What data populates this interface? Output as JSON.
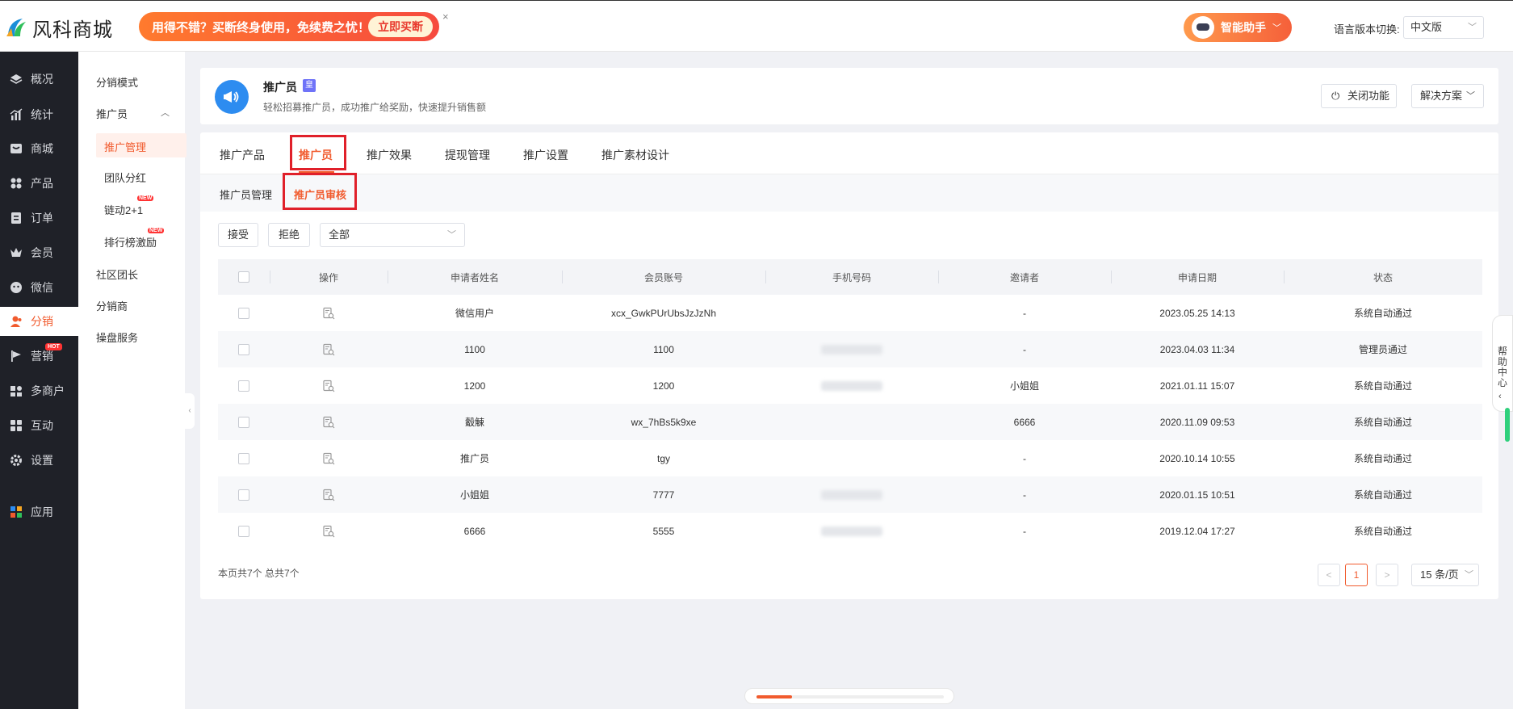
{
  "brand": {
    "name": "风科商城"
  },
  "promo": {
    "text": "用得不错？买断终身使用，免续费之忧！",
    "cta": "立即买断",
    "close": "×"
  },
  "assistant": {
    "label": "智能助手"
  },
  "language": {
    "label": "语言版本切换:",
    "selected": "中文版"
  },
  "sidebar": {
    "items": [
      {
        "label": "概况",
        "icon": "layers-icon"
      },
      {
        "label": "统计",
        "icon": "chart-icon"
      },
      {
        "label": "商城",
        "icon": "store-icon"
      },
      {
        "label": "产品",
        "icon": "grid-icon"
      },
      {
        "label": "订单",
        "icon": "order-icon"
      },
      {
        "label": "会员",
        "icon": "crown-icon"
      },
      {
        "label": "微信",
        "icon": "wechat-icon"
      },
      {
        "label": "分销",
        "icon": "user-icon"
      },
      {
        "label": "营销",
        "icon": "flag-icon",
        "badge": "HOT"
      },
      {
        "label": "多商户",
        "icon": "merchant-icon"
      },
      {
        "label": "互动",
        "icon": "interact-icon"
      },
      {
        "label": "设置",
        "icon": "gear-icon"
      },
      {
        "label": "应用",
        "icon": "apps-icon"
      }
    ]
  },
  "subnav": {
    "mode": "分销模式",
    "promoter": "推广员",
    "manage": "推广管理",
    "team": "团队分红",
    "chain": "链动2+1",
    "rank": "排行榜激励",
    "new_badge": "NEW",
    "community": "社区团长",
    "distributor": "分销商",
    "service": "操盘服务"
  },
  "header": {
    "title": "推广员",
    "badge": "皇",
    "desc": "轻松招募推广员，成功推广给奖励，快速提升销售额",
    "close_fn": "关闭功能",
    "solution": "解决方案"
  },
  "tabs": [
    "推广产品",
    "推广员",
    "推广效果",
    "提现管理",
    "推广设置",
    "推广素材设计"
  ],
  "subtabs": [
    "推广员管理",
    "推广员审核"
  ],
  "toolbar": {
    "accept": "接受",
    "reject": "拒绝",
    "filter": "全部"
  },
  "table": {
    "columns": [
      "操作",
      "申请者姓名",
      "会员账号",
      "手机号码",
      "邀请者",
      "申请日期",
      "状态"
    ],
    "rows": [
      {
        "name": "微信用户",
        "account": "xcx_GwkPUrUbsJzJzNh",
        "phone": "",
        "inviter": "-",
        "date": "2023.05.25 14:13",
        "status": "系统自动通过"
      },
      {
        "name": "1100",
        "account": "1100",
        "phone": "blurred",
        "inviter": "-",
        "date": "2023.04.03 11:34",
        "status": "管理员通过"
      },
      {
        "name": "1200",
        "account": "1200",
        "phone": "blurred",
        "inviter": "小姐姐",
        "date": "2021.01.11 15:07",
        "status": "系统自动通过"
      },
      {
        "name": "觳觫",
        "account": "wx_7hBs5k9xe",
        "phone": "",
        "inviter": "6666",
        "date": "2020.11.09 09:53",
        "status": "系统自动通过"
      },
      {
        "name": "推广员",
        "account": "tgy",
        "phone": "",
        "inviter": "-",
        "date": "2020.10.14 10:55",
        "status": "系统自动通过"
      },
      {
        "name": "小姐姐",
        "account": "7777",
        "phone": "blurred",
        "inviter": "-",
        "date": "2020.01.15 10:51",
        "status": "系统自动通过"
      },
      {
        "name": "6666",
        "account": "5555",
        "phone": "blurred",
        "inviter": "-",
        "date": "2019.12.04 17:27",
        "status": "系统自动通过"
      }
    ]
  },
  "pagination": {
    "summary": "本页共7个 总共7个",
    "prev": "<",
    "current": "1",
    "next": ">",
    "page_size": "15 条/页"
  },
  "help": {
    "label": "帮助中心"
  },
  "colors": {
    "accent": "#f15b2e",
    "sidebar_bg": "#1f2128",
    "highlight_box": "#e0202a"
  }
}
